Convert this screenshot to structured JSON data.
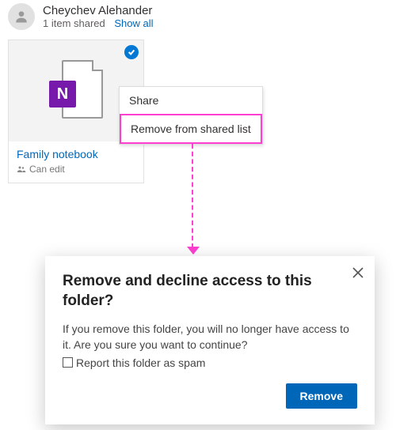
{
  "header": {
    "name": "Cheychev Alehander",
    "summary": "1 item shared",
    "show_all": "Show all"
  },
  "tile": {
    "badge_letter": "N",
    "title": "Family notebook",
    "permission": "Can edit"
  },
  "context_menu": {
    "share": "Share",
    "remove": "Remove from shared list"
  },
  "dialog": {
    "title": "Remove and decline access to this folder?",
    "body": "If you remove this folder, you will no longer have access to it. Are you sure you want to continue?",
    "report_label": "Report this folder as spam",
    "remove_btn": "Remove"
  }
}
